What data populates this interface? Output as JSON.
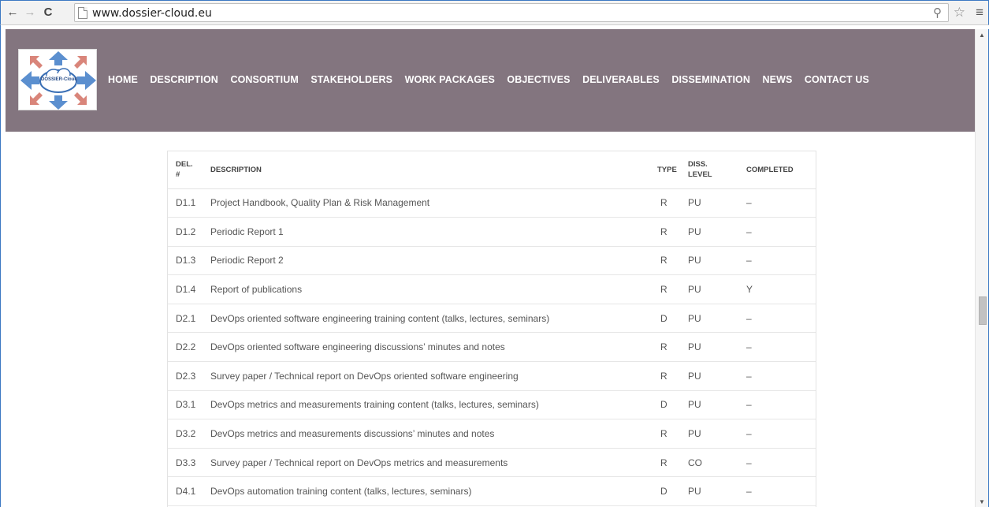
{
  "browser": {
    "url": "www.dossier-cloud.eu",
    "back_icon": "←",
    "forward_icon": "→",
    "reload_icon": "C",
    "zoom_icon": "⚲",
    "star_icon": "☆",
    "menu_icon": "≡"
  },
  "site": {
    "logo_text": "DOSSIER-Cloud",
    "nav": [
      "HOME",
      "DESCRIPTION",
      "CONSORTIUM",
      "STAKEHOLDERS",
      "WORK PACKAGES",
      "OBJECTIVES",
      "DELIVERABLES",
      "DISSEMINATION",
      "NEWS",
      "CONTACT US"
    ]
  },
  "table": {
    "headers": {
      "del_line1": "DEL.",
      "del_line2": "#",
      "description": "DESCRIPTION",
      "type": "TYPE",
      "diss_line1": "DISS.",
      "diss_line2": "LEVEL",
      "completed": "COMPLETED"
    },
    "rows": [
      {
        "del": "D1.1",
        "description": "Project Handbook, Quality Plan & Risk Management",
        "type": "R",
        "diss": "PU",
        "completed": "–"
      },
      {
        "del": "D1.2",
        "description": "Periodic Report 1",
        "type": "R",
        "diss": "PU",
        "completed": "–"
      },
      {
        "del": "D1.3",
        "description": "Periodic Report 2",
        "type": "R",
        "diss": "PU",
        "completed": "–"
      },
      {
        "del": "D1.4",
        "description": "Report of publications",
        "type": "R",
        "diss": "PU",
        "completed": "Y"
      },
      {
        "del": "D2.1",
        "description": "DevOps oriented software engineering training content (talks, lectures, seminars)",
        "type": "D",
        "diss": "PU",
        "completed": "–"
      },
      {
        "del": "D2.2",
        "description": "DevOps oriented software engineering discussions’ minutes and notes",
        "type": "R",
        "diss": "PU",
        "completed": "–"
      },
      {
        "del": "D2.3",
        "description": "Survey paper / Technical report on DevOps oriented software engineering",
        "type": "R",
        "diss": "PU",
        "completed": "–"
      },
      {
        "del": "D3.1",
        "description": "DevOps metrics and measurements training content (talks, lectures, seminars)",
        "type": "D",
        "diss": "PU",
        "completed": "–"
      },
      {
        "del": "D3.2",
        "description": "DevOps metrics and measurements discussions’ minutes and notes",
        "type": "R",
        "diss": "PU",
        "completed": "–"
      },
      {
        "del": "D3.3",
        "description": "Survey paper / Technical report on DevOps metrics and measurements",
        "type": "R",
        "diss": "CO",
        "completed": "–"
      },
      {
        "del": "D4.1",
        "description": "DevOps automation training content (talks, lectures, seminars)",
        "type": "D",
        "diss": "PU",
        "completed": "–"
      }
    ]
  },
  "scrollbar": {
    "position_fraction": 0.6
  }
}
